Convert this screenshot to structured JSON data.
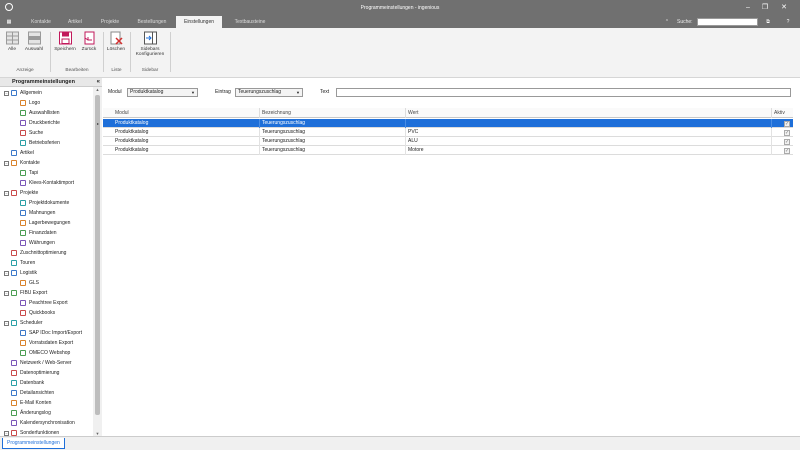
{
  "window": {
    "title": "Programmeinstellungen - ingenious"
  },
  "tabs": [
    {
      "label": "Kontakte"
    },
    {
      "label": "Artikel"
    },
    {
      "label": "Projekte"
    },
    {
      "label": "Bestellungen"
    },
    {
      "label": "Einstellungen",
      "active": true
    },
    {
      "label": "Textbausteine"
    }
  ],
  "search": {
    "label": "Suche:",
    "value": ""
  },
  "ribbon": {
    "buttons": [
      {
        "label": "Alle",
        "icon": "grid-all-icon"
      },
      {
        "label": "Auswahl",
        "icon": "grid-selection-icon"
      },
      {
        "label": "Speichern",
        "icon": "save-icon"
      },
      {
        "label": "Zurück",
        "icon": "undo-icon"
      },
      {
        "label": "Löschen",
        "icon": "delete-icon"
      },
      {
        "label": "Sidebars",
        "label2": "Konfigurieren",
        "icon": "sidebar-config-icon"
      }
    ],
    "groups": [
      {
        "label": "Anzeige"
      },
      {
        "label": "Bearbeiten"
      },
      {
        "label": "Liste"
      },
      {
        "label": "Sidebar"
      }
    ]
  },
  "sidebar": {
    "title": "Programmeinstellungen",
    "collapse_glyph": "«",
    "items": [
      {
        "label": "Allgemein",
        "level": 0,
        "expanded": true,
        "icon": "settings-icon"
      },
      {
        "label": "Logo",
        "level": 1,
        "icon": "image-icon"
      },
      {
        "label": "Auswahllisten",
        "level": 1,
        "icon": "list-icon"
      },
      {
        "label": "Druckberichte",
        "level": 1,
        "icon": "printer-icon"
      },
      {
        "label": "Suche",
        "level": 1,
        "icon": "binoculars-icon"
      },
      {
        "label": "Betriebsferien",
        "level": 1,
        "icon": "beach-icon"
      },
      {
        "label": "Artikel",
        "level": 0,
        "icon": "box-icon"
      },
      {
        "label": "Kontakte",
        "level": 0,
        "expanded": true,
        "icon": "contacts-icon"
      },
      {
        "label": "Tapi",
        "level": 1,
        "icon": "phone-icon"
      },
      {
        "label": "Klees-Kontaktimport",
        "level": 1,
        "icon": "import-icon"
      },
      {
        "label": "Projekte",
        "level": 0,
        "expanded": true,
        "icon": "document-icon"
      },
      {
        "label": "Projektdokumente",
        "level": 1,
        "icon": "document-icon"
      },
      {
        "label": "Mahnungen",
        "level": 1,
        "icon": "reminder-icon"
      },
      {
        "label": "Lagerbewegungen",
        "level": 1,
        "icon": "warehouse-icon"
      },
      {
        "label": "Finanzdaten",
        "level": 1,
        "icon": "finance-icon"
      },
      {
        "label": "Währungen",
        "level": 1,
        "icon": "currency-icon"
      },
      {
        "label": "Zuschnittoptimierung",
        "level": 0,
        "icon": "cut-icon"
      },
      {
        "label": "Touren",
        "level": 0,
        "icon": "truck-icon"
      },
      {
        "label": "Logistik",
        "level": 0,
        "expanded": true,
        "icon": "logistics-icon"
      },
      {
        "label": "GLS",
        "level": 1,
        "icon": "package-icon"
      },
      {
        "label": "FIBU Export",
        "level": 0,
        "expanded": true,
        "icon": "export-icon"
      },
      {
        "label": "Peachtree Export",
        "level": 1,
        "icon": "export-icon"
      },
      {
        "label": "Quickbooks",
        "level": 1,
        "icon": "export-icon"
      },
      {
        "label": "Scheduler",
        "level": 0,
        "expanded": true,
        "icon": "clock-icon"
      },
      {
        "label": "SAP IDoc Import/Export",
        "level": 1,
        "icon": "sap-icon"
      },
      {
        "label": "Vorratsdaten Export",
        "level": 1,
        "icon": "export-icon"
      },
      {
        "label": "OMECO Webshop",
        "level": 1,
        "icon": "webshop-icon"
      },
      {
        "label": "Netzwerk / Web-Server",
        "level": 0,
        "icon": "network-icon"
      },
      {
        "label": "Datenoptimierung",
        "level": 0,
        "icon": "optimize-icon"
      },
      {
        "label": "Datenbank",
        "level": 0,
        "icon": "database-icon"
      },
      {
        "label": "Detailansichten",
        "level": 0,
        "icon": "detail-icon"
      },
      {
        "label": "E-Mail Konten",
        "level": 0,
        "icon": "mail-icon"
      },
      {
        "label": "Änderungslog",
        "level": 0,
        "icon": "log-icon"
      },
      {
        "label": "Kalendersynchronisation",
        "level": 0,
        "icon": "calendar-icon"
      },
      {
        "label": "Sonderfunktionen",
        "level": 0,
        "expanded": true,
        "icon": "special-icon"
      }
    ]
  },
  "filters": {
    "modul_label": "Modul",
    "modul_value": "Produktkatalog",
    "eintrag_label": "Eintrag",
    "eintrag_value": "Teuerungszuschlag",
    "text_label": "Text",
    "text_value": ""
  },
  "grid": {
    "columns": [
      "Modul",
      "Bezeichnung",
      "Wert",
      "Aktiv"
    ],
    "rows": [
      {
        "modul": "Produktkatalog",
        "bezeichnung": "Teuerungszuschlag",
        "wert": "",
        "aktiv": true,
        "selected": true
      },
      {
        "modul": "Produktkatalog",
        "bezeichnung": "Teuerungszuschlag",
        "wert": "PVC",
        "aktiv": true
      },
      {
        "modul": "Produktkatalog",
        "bezeichnung": "Teuerungszuschlag",
        "wert": "ALU",
        "aktiv": true
      },
      {
        "modul": "Produktkatalog",
        "bezeichnung": "Teuerungszuschlag",
        "wert": "Motore",
        "aktiv": true
      }
    ]
  },
  "statusbar": {
    "tab_label": "Programmeinstellungen"
  },
  "colors": {
    "accent": "#1e6fd9",
    "titlebar": "#707070"
  }
}
